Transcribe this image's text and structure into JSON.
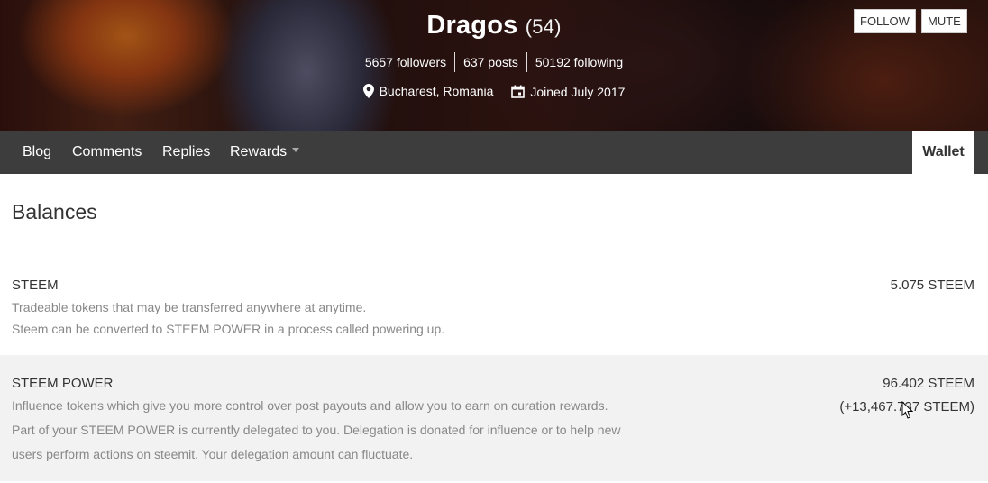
{
  "profile": {
    "name": "Dragos",
    "reputation": "(54)",
    "followers": "5657 followers",
    "posts": "637 posts",
    "following": "50192 following",
    "location": "Bucharest, Romania",
    "joined": "Joined July 2017",
    "follow_label": "FOLLOW",
    "mute_label": "MUTE"
  },
  "nav": {
    "items": [
      {
        "label": "Blog"
      },
      {
        "label": "Comments"
      },
      {
        "label": "Replies"
      },
      {
        "label": "Rewards"
      }
    ],
    "active": "Wallet"
  },
  "balances": {
    "title": "Balances",
    "steem": {
      "name": "STEEM",
      "desc1": "Tradeable tokens that may be transferred anywhere at anytime.",
      "desc2": "Steem can be converted to STEEM POWER in a process called powering up.",
      "value": "5.075 STEEM"
    },
    "steem_power": {
      "name": "STEEM POWER",
      "desc1": "Influence tokens which give you more control over post payouts and allow you to earn on curation rewards.",
      "desc2": "Part of your STEEM POWER is currently delegated to you. Delegation is donated for influence or to help new",
      "desc3": "users perform actions on steemit. Your delegation amount can fluctuate.",
      "value": "96.402 STEEM",
      "delegated": "(+13,467.737 STEEM)"
    }
  },
  "icons": {
    "location": "map-pin-icon",
    "calendar": "calendar-icon",
    "caret": "chevron-down-icon",
    "cursor": "mouse-pointer-icon"
  }
}
